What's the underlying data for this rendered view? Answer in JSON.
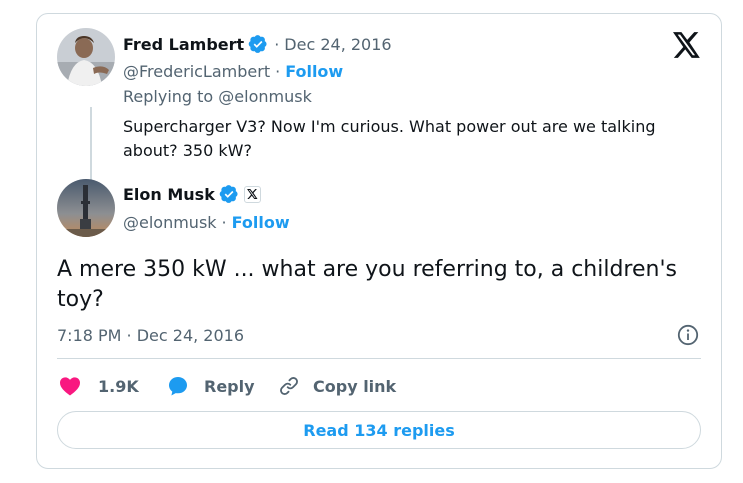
{
  "colors": {
    "accent": "#1d9bf0",
    "text": "#0f1419",
    "muted": "#536471",
    "like": "#f91880",
    "border": "#cfd9de"
  },
  "parent_tweet": {
    "author_name": "Fred Lambert",
    "separator": "·",
    "date": "Dec 24, 2016",
    "handle": "@FredericLambert",
    "follow_sep": "·",
    "follow_label": "Follow",
    "replying_to": "Replying to @elonmusk",
    "text": "Supercharger V3? Now I'm curious. What power out are we talking about? 350 kW?"
  },
  "tweet": {
    "author_name": "Elon Musk",
    "handle": "@elonmusk",
    "follow_sep": "·",
    "follow_label": "Follow",
    "text": "A mere 350 kW ... what are you referring to, a children's toy?",
    "timestamp": "7:18 PM · Dec 24, 2016"
  },
  "actions": {
    "like_count": "1.9K",
    "reply_label": "Reply",
    "copy_link_label": "Copy link",
    "read_replies_label": "Read 134 replies"
  },
  "icons": [
    "x-logo-icon",
    "verified-badge-icon",
    "x-affiliate-badge-icon",
    "info-icon",
    "heart-icon",
    "reply-bubble-icon",
    "link-icon"
  ]
}
